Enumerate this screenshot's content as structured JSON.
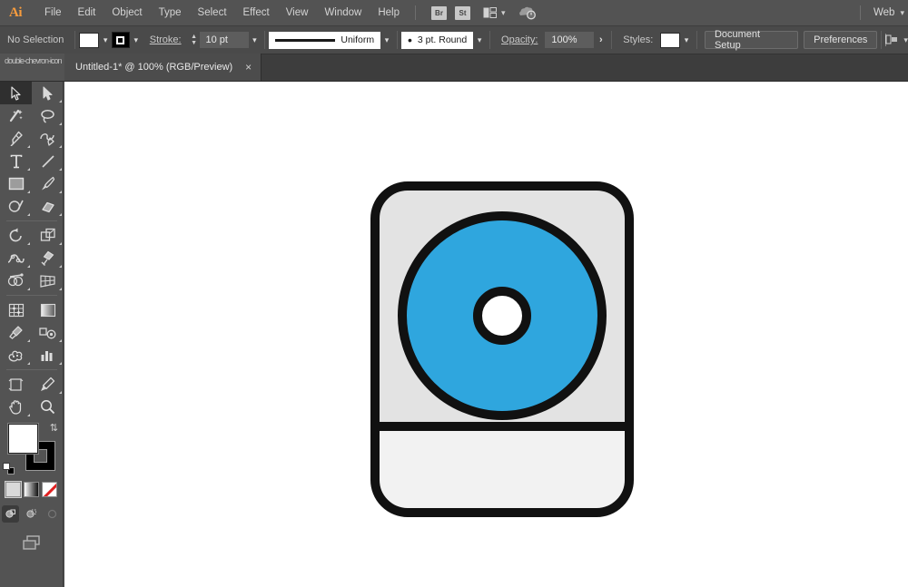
{
  "app": {
    "name": "Adobe Illustrator",
    "logo": "Ai"
  },
  "menubar": {
    "items": [
      "File",
      "Edit",
      "Object",
      "Type",
      "Select",
      "Effect",
      "View",
      "Window",
      "Help"
    ],
    "bridge_button": "Br",
    "stock_button": "St",
    "arrange_icon": "arrange-documents-icon",
    "cloud_icon": "cloud-sync-icon",
    "workspace_label": "Web"
  },
  "controlbar": {
    "selection_status": "No Selection",
    "fill_swatch": "#ffffff",
    "stroke_swatch": "#000000",
    "stroke_label": "Stroke:",
    "stroke_weight": "10 pt",
    "stroke_profile": "Uniform",
    "brush_definition": "3 pt. Round",
    "opacity_label": "Opacity:",
    "opacity_value": "100%",
    "styles_label": "Styles:",
    "styles_swatch": "#ffffff",
    "document_setup_button": "Document Setup",
    "preferences_button": "Preferences",
    "align_icon": "align-to-pixel-grid-icon"
  },
  "tabbar": {
    "collapse_icon": "double-chevron-icon",
    "document_title": "Untitled-1* @ 100% (RGB/Preview)",
    "close_icon": "×"
  },
  "toolbar": {
    "tools": [
      {
        "name": "selection-tool",
        "label": "Selection",
        "active": true,
        "has_flyout": false
      },
      {
        "name": "direct-selection-tool",
        "label": "Direct Selection",
        "active": false,
        "has_flyout": true
      },
      {
        "name": "magic-wand-tool",
        "label": "Magic Wand",
        "active": false,
        "has_flyout": false
      },
      {
        "name": "lasso-tool",
        "label": "Lasso",
        "active": false,
        "has_flyout": true
      },
      {
        "name": "pen-tool",
        "label": "Pen",
        "active": false,
        "has_flyout": true
      },
      {
        "name": "curvature-tool",
        "label": "Curvature",
        "active": false,
        "has_flyout": true
      },
      {
        "name": "type-tool",
        "label": "Type",
        "active": false,
        "has_flyout": true
      },
      {
        "name": "line-segment-tool",
        "label": "Line Segment",
        "active": false,
        "has_flyout": true
      },
      {
        "name": "rectangle-tool",
        "label": "Rectangle",
        "active": false,
        "has_flyout": true
      },
      {
        "name": "paintbrush-tool",
        "label": "Paintbrush",
        "active": false,
        "has_flyout": true
      },
      {
        "name": "shaper-tool",
        "label": "Shaper",
        "active": false,
        "has_flyout": true
      },
      {
        "name": "eraser-tool",
        "label": "Eraser",
        "active": false,
        "has_flyout": true
      },
      {
        "name": "rotate-tool",
        "label": "Rotate",
        "active": false,
        "has_flyout": true
      },
      {
        "name": "scale-tool",
        "label": "Scale",
        "active": false,
        "has_flyout": true
      },
      {
        "name": "width-tool",
        "label": "Width",
        "active": false,
        "has_flyout": true
      },
      {
        "name": "free-transform-tool",
        "label": "Free Transform",
        "active": false,
        "has_flyout": true
      },
      {
        "name": "shape-builder-tool",
        "label": "Shape Builder",
        "active": false,
        "has_flyout": true
      },
      {
        "name": "perspective-grid-tool",
        "label": "Perspective Grid",
        "active": false,
        "has_flyout": true
      },
      {
        "name": "mesh-tool",
        "label": "Mesh",
        "active": false,
        "has_flyout": false
      },
      {
        "name": "gradient-tool",
        "label": "Gradient",
        "active": false,
        "has_flyout": false
      },
      {
        "name": "eyedropper-tool",
        "label": "Eyedropper",
        "active": false,
        "has_flyout": true
      },
      {
        "name": "blend-tool",
        "label": "Blend",
        "active": false,
        "has_flyout": true
      },
      {
        "name": "symbol-sprayer-tool",
        "label": "Symbol Sprayer",
        "active": false,
        "has_flyout": true
      },
      {
        "name": "column-graph-tool",
        "label": "Column Graph",
        "active": false,
        "has_flyout": true
      },
      {
        "name": "artboard-tool",
        "label": "Artboard",
        "active": false,
        "has_flyout": false
      },
      {
        "name": "slice-tool",
        "label": "Slice",
        "active": false,
        "has_flyout": true
      },
      {
        "name": "hand-tool",
        "label": "Hand",
        "active": false,
        "has_flyout": true
      },
      {
        "name": "zoom-tool",
        "label": "Zoom",
        "active": false,
        "has_flyout": false
      }
    ],
    "fill_color": "#ffffff",
    "stroke_color": "#000000",
    "swap_icon": "swap-fill-stroke-icon",
    "default_icon": "default-fill-stroke-icon",
    "color_modes": [
      {
        "name": "color-mode-button",
        "selected": true
      },
      {
        "name": "gradient-mode-button",
        "selected": false
      },
      {
        "name": "none-mode-button",
        "selected": false
      }
    ],
    "draw_modes": [
      {
        "name": "draw-normal-button",
        "selected": true
      },
      {
        "name": "draw-behind-button",
        "selected": false
      },
      {
        "name": "draw-inside-button",
        "selected": false
      }
    ],
    "screen_mode_icon": "change-screen-mode-icon"
  },
  "canvas": {
    "background": "#ffffff",
    "artwork": {
      "name": "cd-disc-drive-illustration",
      "outline_color": "#111111",
      "body_top_fill": "#e3e3e3",
      "body_bottom_fill": "#f2f2f2",
      "disc_fill": "#2fa6de",
      "hub_fill": "#ffffff",
      "stroke_width": "10"
    }
  }
}
